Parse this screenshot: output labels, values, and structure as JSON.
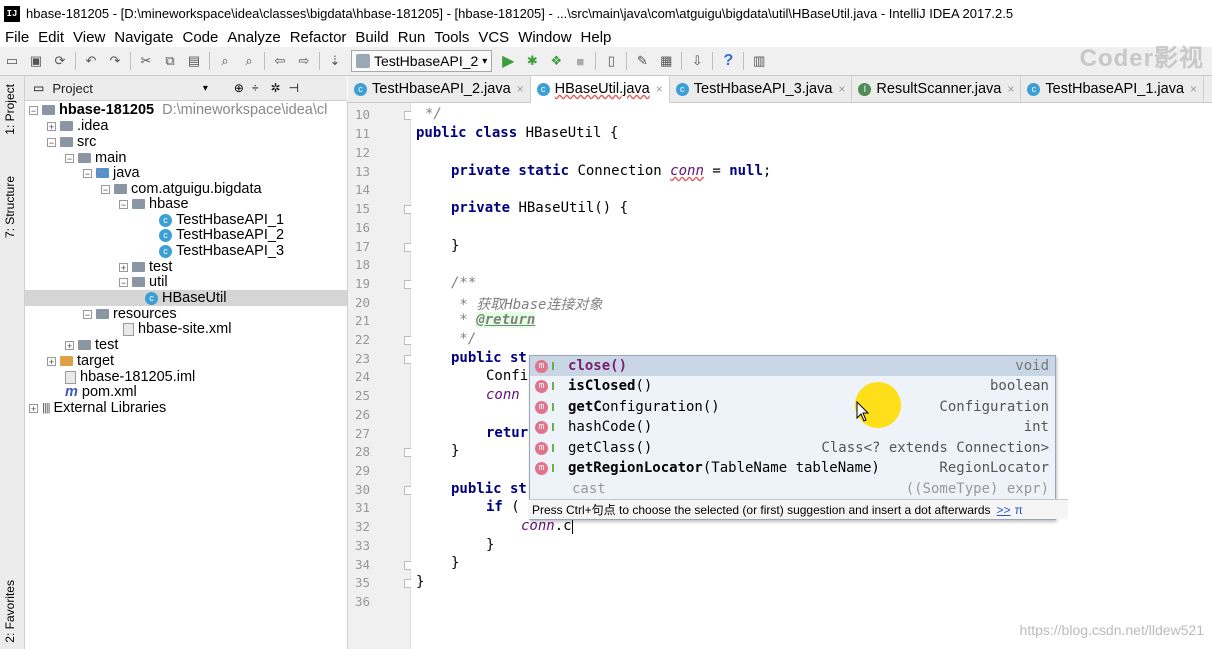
{
  "window": {
    "title": "hbase-181205 - [D:\\mineworkspace\\idea\\classes\\bigdata\\hbase-181205] - [hbase-181205] - ...\\src\\main\\java\\com\\atguigu\\bigdata\\util\\HBaseUtil.java - IntelliJ IDEA 2017.2.5"
  },
  "menu": [
    "File",
    "Edit",
    "View",
    "Navigate",
    "Code",
    "Analyze",
    "Refactor",
    "Build",
    "Run",
    "Tools",
    "VCS",
    "Window",
    "Help"
  ],
  "toolbar": {
    "run_config": "TestHbaseAPI_2"
  },
  "watermark": "Coder影视",
  "side_tabs": {
    "project": "1: Project",
    "structure": "7: Structure",
    "favorites": "2: Favorites"
  },
  "project_panel": {
    "title": "Project",
    "tree": [
      {
        "label": "hbase-181205",
        "path": "D:\\mineworkspace\\idea\\cl"
      },
      {
        "label": ".idea"
      },
      {
        "label": "src"
      },
      {
        "label": "main"
      },
      {
        "label": "java"
      },
      {
        "label": "com.atguigu.bigdata"
      },
      {
        "label": "hbase"
      },
      {
        "label": "TestHbaseAPI_1"
      },
      {
        "label": "TestHbaseAPI_2"
      },
      {
        "label": "TestHbaseAPI_3"
      },
      {
        "label": "test"
      },
      {
        "label": "util"
      },
      {
        "label": "HBaseUtil"
      },
      {
        "label": "resources"
      },
      {
        "label": "hbase-site.xml"
      },
      {
        "label": "test"
      },
      {
        "label": "target"
      },
      {
        "label": "hbase-181205.iml"
      },
      {
        "label": "pom.xml"
      },
      {
        "label": "External Libraries"
      }
    ]
  },
  "tabs": [
    {
      "label": "TestHbaseAPI_2.java"
    },
    {
      "label": "HBaseUtil.java"
    },
    {
      "label": "TestHbaseAPI_3.java"
    },
    {
      "label": "ResultScanner.java"
    },
    {
      "label": "TestHbaseAPI_1.java"
    }
  ],
  "line_numbers": [
    "10",
    "11",
    "12",
    "13",
    "14",
    "15",
    "16",
    "17",
    "18",
    "19",
    "20",
    "21",
    "22",
    "23",
    "24",
    "25",
    "26",
    "27",
    "28",
    "29",
    "30",
    "31",
    "32",
    "33",
    "34",
    "35",
    "36"
  ],
  "code": {
    "l10": "*/",
    "l11_kw": "public class",
    "l11_rest": " HBaseUtil {",
    "l13_kw": "private static",
    "l13_a": " Connection ",
    "l13_fld": "conn",
    "l13_b": " = ",
    "l13_null": "null",
    "l13_c": ";",
    "l15_kw": "private",
    "l15_rest": " HBaseUtil() {",
    "l17": "}",
    "l19": "/**",
    "l20_a": " * 获取",
    "l20_it": "Hbase",
    "l20_b": "连接对象",
    "l21_a": " * ",
    "l21_tag": "@return",
    "l22": " */",
    "l23_kw": "public st",
    "l24": "Confi",
    "l25": "conn",
    "l27_kw": "retur",
    "l28": "}",
    "l30_kw": "public st",
    "l31_kw": "if",
    "l31_rest": " (",
    "l32_fld": "conn",
    "l32_rest": ".c",
    "l33": "}",
    "l34": "}",
    "l35": "}"
  },
  "completion": {
    "items": [
      {
        "name_hl": "c",
        "name": "lose",
        "args": "()",
        "type": "void"
      },
      {
        "name_hl": "isC",
        "name": "losed",
        "args": "()",
        "type": "boolean"
      },
      {
        "name_hl": "getC",
        "name": "onfiguration",
        "args": "()",
        "type": "Configuration"
      },
      {
        "name_hl": "hashC",
        "name": "ode",
        "args": "()",
        "type": "int"
      },
      {
        "name_hl": "getC",
        "name": "lass",
        "args": "()",
        "type": "Class<? extends Connection>"
      },
      {
        "name_hl": "getRegionLocator",
        "name": "",
        "args": "(TableName tableName)",
        "type": "RegionLocator"
      },
      {
        "name_hl": "",
        "name": "cast",
        "args": "",
        "type": "((SomeType) expr)"
      }
    ],
    "hint": "Press Ctrl+句点 to choose the selected (or first) suggestion and insert a dot afterwards",
    "more": ">>",
    "pi": "π"
  },
  "footer_watermark": "https://blog.csdn.net/lldew521"
}
